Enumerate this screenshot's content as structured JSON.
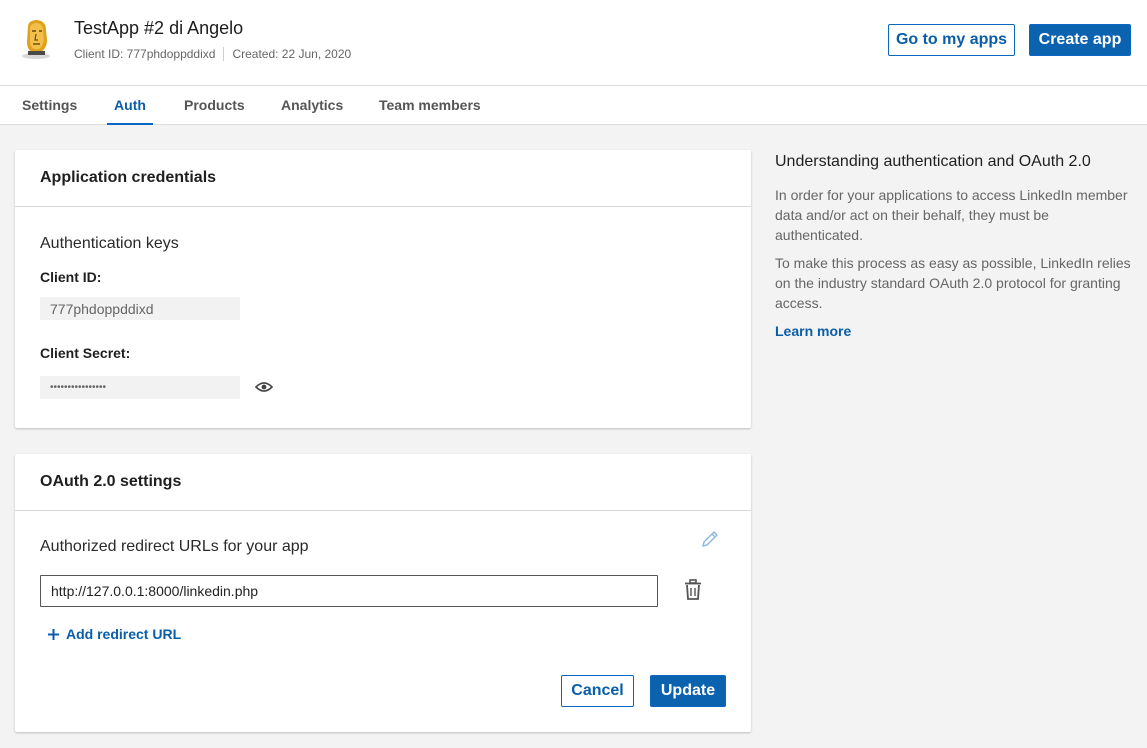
{
  "app": {
    "title": "TestApp #2 di Angelo",
    "client_id_meta": "Client ID: 777phdoppddixd",
    "created_meta": "Created: 22 Jun, 2020"
  },
  "header_buttons": {
    "go_to_apps": "Go to my apps",
    "create_app": "Create app"
  },
  "tabs": [
    {
      "label": "Settings",
      "active": false
    },
    {
      "label": "Auth",
      "active": true
    },
    {
      "label": "Products",
      "active": false
    },
    {
      "label": "Analytics",
      "active": false
    },
    {
      "label": "Team members",
      "active": false
    }
  ],
  "credentials": {
    "title": "Application credentials",
    "subtitle": "Authentication keys",
    "client_id_label": "Client ID:",
    "client_id_value": "777phdoppddixd",
    "client_secret_label": "Client Secret:",
    "client_secret_value": "••••••••••••••••"
  },
  "oauth": {
    "title": "OAuth 2.0 settings",
    "subtitle": "Authorized redirect URLs for your app",
    "redirect_url": "http://127.0.0.1:8000/linkedin.php",
    "add_label": "Add redirect URL",
    "cancel": "Cancel",
    "update": "Update"
  },
  "sidebar": {
    "title": "Understanding authentication and OAuth 2.0",
    "para1": "In order for your applications to access LinkedIn member data and/or act on their behalf, they must be authenticated.",
    "para2": "To make this process as easy as possible, LinkedIn relies on the industry standard OAuth 2.0 protocol for granting access.",
    "learn_more": "Learn more"
  },
  "colors": {
    "brand": "#0a66c2",
    "background": "#f3f3f3"
  },
  "icons": {
    "logo": "app-logo",
    "eye": "eye-icon",
    "pencil": "pencil-icon",
    "trash": "trash-icon",
    "plus": "plus-icon"
  }
}
